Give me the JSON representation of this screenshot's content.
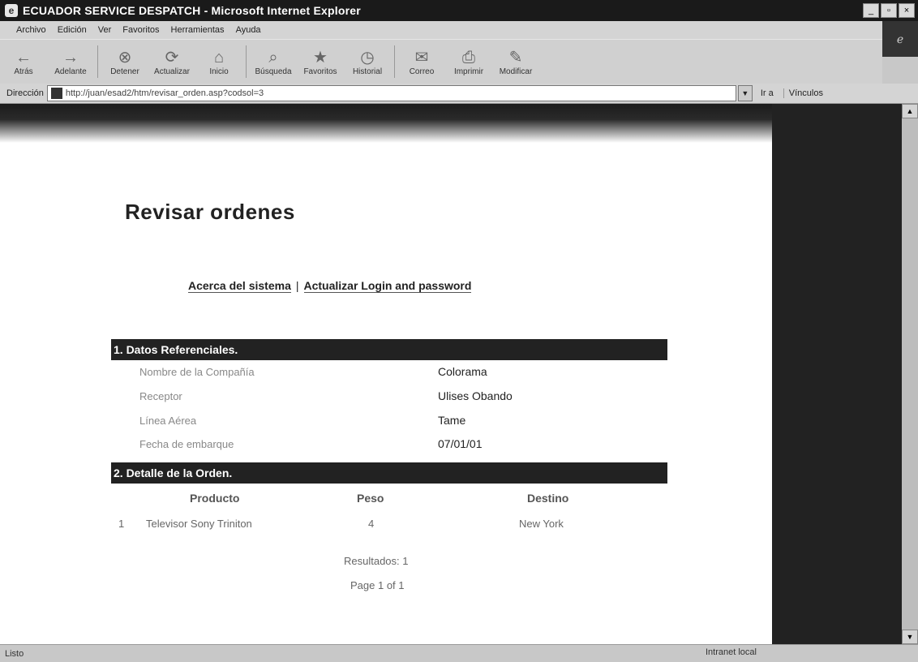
{
  "window": {
    "title": "ECUADOR SERVICE DESPATCH - Microsoft Internet Explorer",
    "controls": [
      "_",
      "▫",
      "×"
    ]
  },
  "menu": [
    "Archivo",
    "Edición",
    "Ver",
    "Favoritos",
    "Herramientas",
    "Ayuda"
  ],
  "toolbar": [
    {
      "label": "Atrás",
      "icon": "←"
    },
    {
      "label": "Adelante",
      "icon": "→"
    },
    {
      "label": "Detener",
      "icon": "⊗"
    },
    {
      "label": "Actualizar",
      "icon": "⟳"
    },
    {
      "label": "Inicio",
      "icon": "⌂"
    },
    {
      "label": "Búsqueda",
      "icon": "⌕"
    },
    {
      "label": "Favoritos",
      "icon": "★"
    },
    {
      "label": "Historial",
      "icon": "◷"
    },
    {
      "label": "Correo",
      "icon": "✉"
    },
    {
      "label": "Imprimir",
      "icon": "⎙"
    },
    {
      "label": "Modificar",
      "icon": "✎"
    }
  ],
  "address": {
    "label": "Dirección",
    "url": "http://juan/esad2/htm/revisar_orden.asp?codsol=3",
    "go": "Ir a",
    "links": "Vínculos"
  },
  "page": {
    "title": "Revisar ordenes",
    "nav": {
      "link1": "Acerca del sistema",
      "sep": "|",
      "link2": "Actualizar Login and password"
    },
    "section1": "1. Datos Referenciales.",
    "fields": [
      {
        "label": "Nombre de la Compañía",
        "value": "Colorama"
      },
      {
        "label": "Receptor",
        "value": "Ulises Obando"
      },
      {
        "label": "Línea Aérea",
        "value": "Tame"
      },
      {
        "label": "Fecha de embarque",
        "value": "07/01/01"
      }
    ],
    "section2": "2. Detalle de la Orden.",
    "columns": {
      "producto": "Producto",
      "peso": "Peso",
      "destino": "Destino"
    },
    "row": {
      "num": "1",
      "producto": "Televisor Sony Triniton",
      "peso": "4",
      "destino": "New York"
    },
    "results": "Resultados: 1",
    "pagination": "Page 1 of 1"
  },
  "status": {
    "left": "Listo",
    "zone": "Intranet local"
  }
}
